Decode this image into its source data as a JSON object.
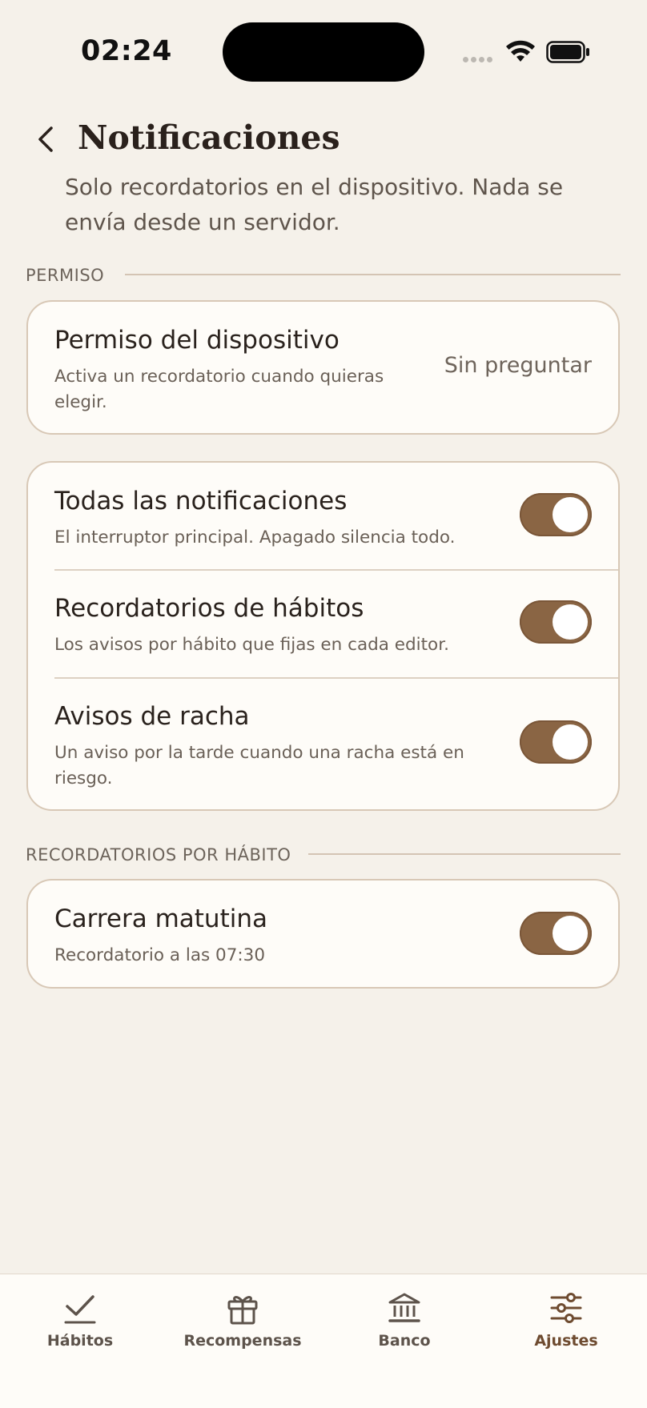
{
  "status_bar": {
    "time": "02:24"
  },
  "header": {
    "title": "Notificaciones",
    "subtitle": "Solo recordatorios en el dispositivo. Nada se envía desde un servidor."
  },
  "sections": {
    "permission": {
      "label": "PERMISO",
      "title": "Permiso del dispositivo",
      "description": "Activa un recordatorio cuando quieras elegir.",
      "value": "Sin preguntar"
    },
    "toggles": [
      {
        "title": "Todas las notificaciones",
        "description": "El interruptor principal. Apagado silencia todo.",
        "on": true
      },
      {
        "title": "Recordatorios de hábitos",
        "description": "Los avisos por hábito que fijas en cada editor.",
        "on": true
      },
      {
        "title": "Avisos de racha",
        "description": "Un aviso por la tarde cuando una racha está en riesgo.",
        "on": true
      }
    ],
    "per_habit": {
      "label": "RECORDATORIOS POR HÁBITO",
      "items": [
        {
          "title": "Carrera matutina",
          "description": "Recordatorio a las 07:30",
          "on": true
        }
      ]
    }
  },
  "tabbar": {
    "tabs": [
      {
        "label": "Hábitos",
        "icon": "check-icon"
      },
      {
        "label": "Recompensas",
        "icon": "gift-icon"
      },
      {
        "label": "Banco",
        "icon": "bank-icon"
      },
      {
        "label": "Ajustes",
        "icon": "sliders-icon",
        "active": true
      }
    ]
  },
  "colors": {
    "accent": "#8a6544",
    "background": "#f5f1ea",
    "card": "#fefcf8",
    "border": "#d8c8b6"
  }
}
